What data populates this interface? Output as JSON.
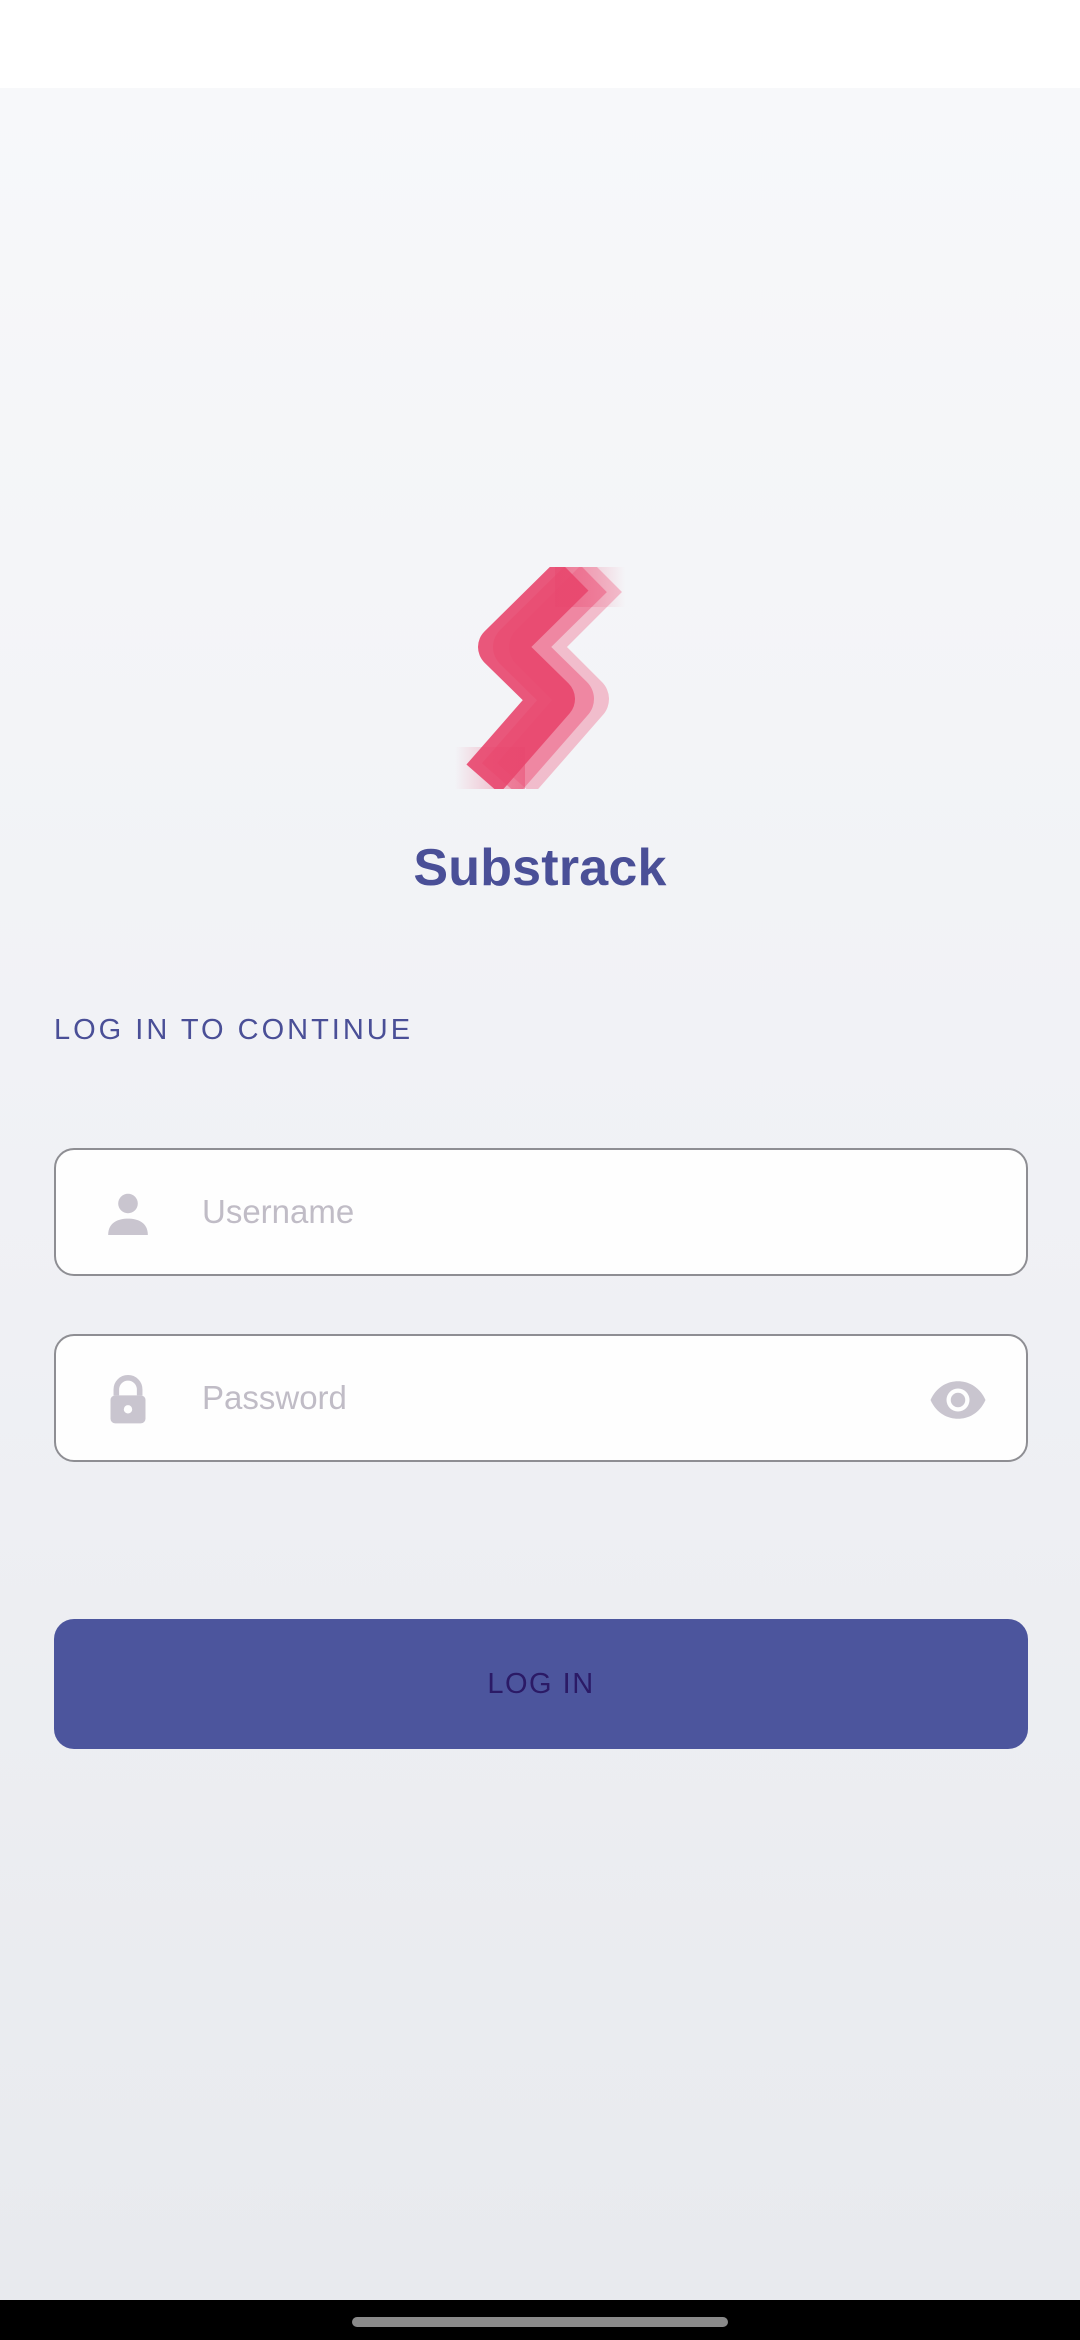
{
  "app": {
    "name": "Substrack"
  },
  "login": {
    "subtitle": "LOG IN TO CONTINUE",
    "username": {
      "value": "",
      "placeholder": "Username",
      "icon": "person-icon"
    },
    "password": {
      "value": "",
      "placeholder": "Password",
      "icon": "lock-icon",
      "toggle_icon": "eye-icon"
    },
    "submit_label": "LOG IN"
  },
  "colors": {
    "brand": "#4a4f97",
    "button": "#4c559d",
    "button_text": "#2b1a66",
    "logo": "#e8466d",
    "icon_muted": "#c9c5cf"
  }
}
